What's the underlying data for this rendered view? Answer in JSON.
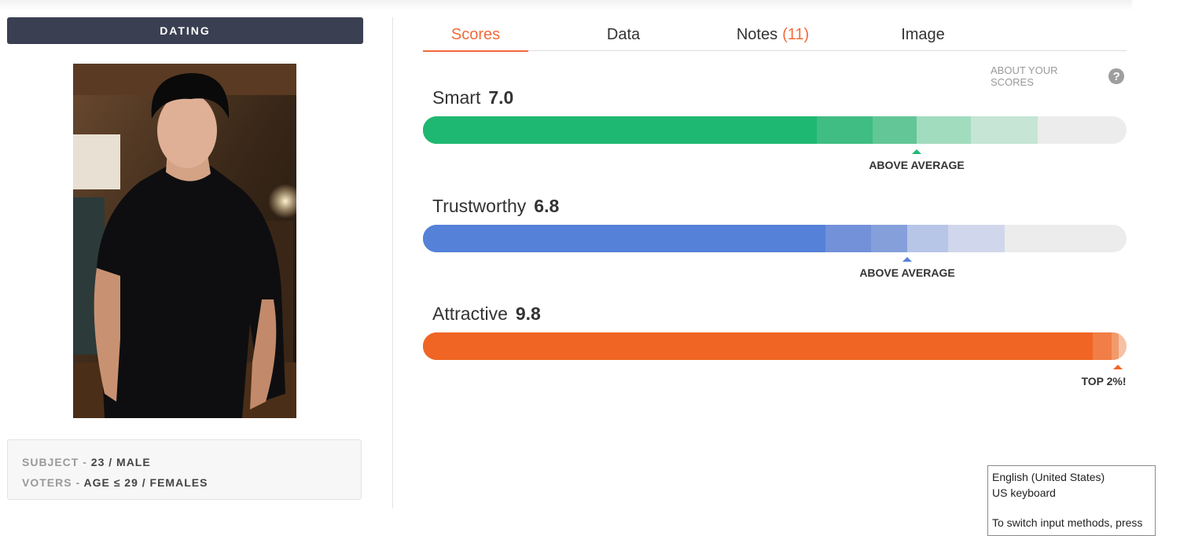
{
  "category": "DATING",
  "photo": {
    "description_icon": "portrait-photo"
  },
  "subject": {
    "subject_key": "SUBJECT - ",
    "subject_value": "23 / MALE",
    "voters_key": "VOTERS - ",
    "voters_value": "AGE ≤ 29 / FEMALES"
  },
  "tabs": [
    {
      "label": "Scores",
      "active": true
    },
    {
      "label": "Data"
    },
    {
      "label": "Notes",
      "count": "(11)"
    },
    {
      "label": "Image"
    }
  ],
  "about": {
    "label": "ABOUT YOUR SCORES",
    "icon": "question-circle-icon"
  },
  "scores": [
    {
      "label": "Smart",
      "value": "7.0",
      "color": "#1fb872",
      "rank": "ABOVE AVERAGE"
    },
    {
      "label": "Trustworthy",
      "value": "6.8",
      "color": "#5581d8",
      "rank": "ABOVE AVERAGE"
    },
    {
      "label": "Attractive",
      "value": "9.8",
      "color": "#f06524",
      "rank": "TOP 2%!"
    }
  ],
  "tooltip": {
    "line1": "English (United States)",
    "line2": "US keyboard",
    "line3": "To switch input methods, press"
  }
}
